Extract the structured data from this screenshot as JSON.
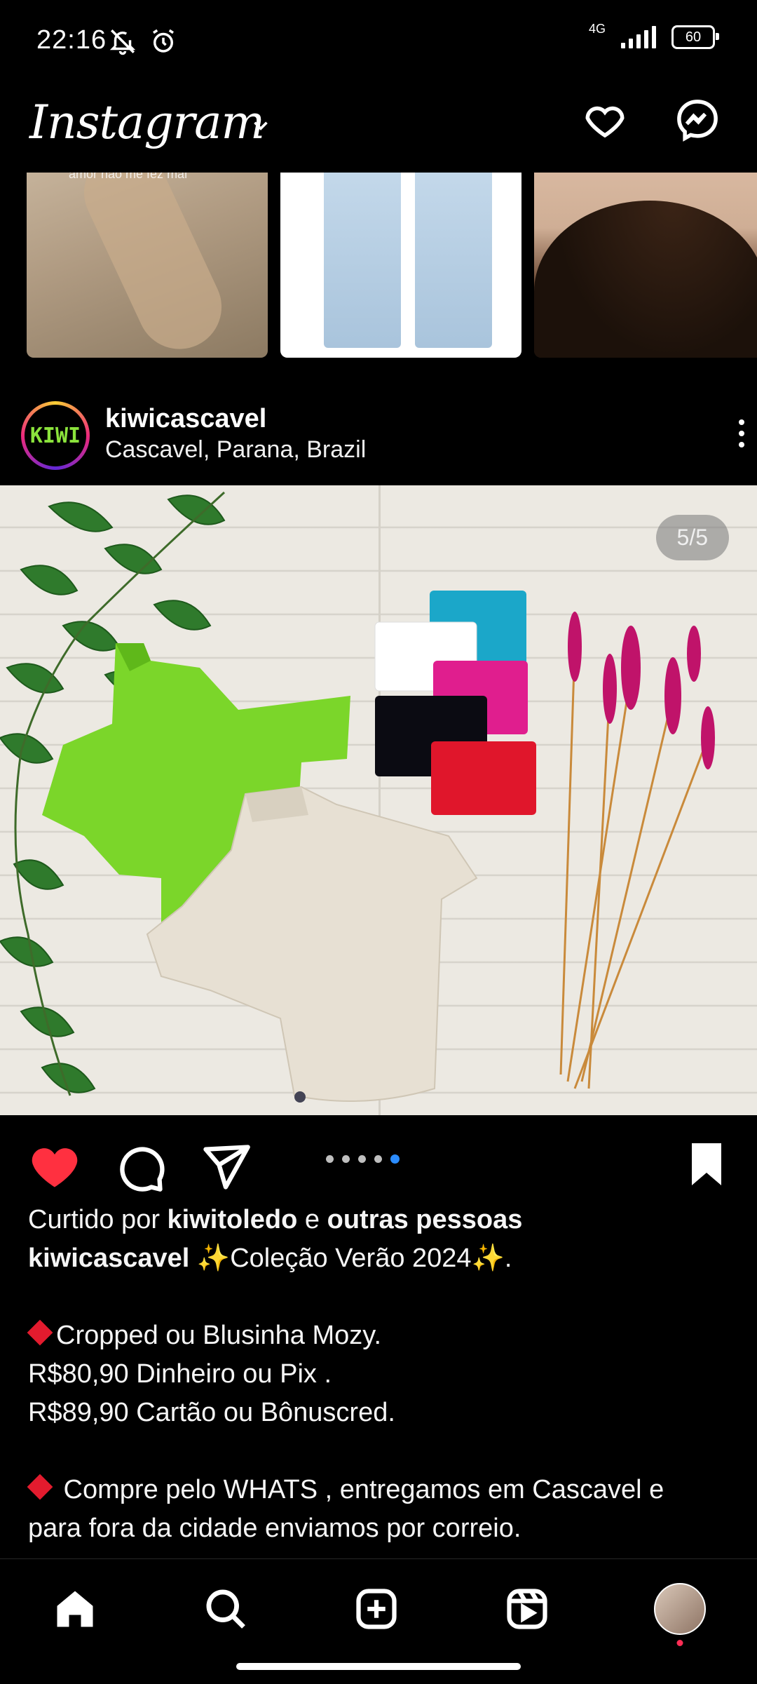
{
  "status_bar": {
    "time": "22:16",
    "network": "4G",
    "battery": "60"
  },
  "app": {
    "logo_text": "Instagram"
  },
  "stories": {
    "first_caption": "amor não me fez mal"
  },
  "post": {
    "username": "kiwicascavel",
    "location": "Cascavel, Parana, Brazil",
    "avatar_text": "KIWI",
    "image_counter": "5/5",
    "carousel": {
      "total": 5,
      "active": 5
    },
    "liked": true,
    "saved": true,
    "likes_prefix": "Curtido por",
    "likes_user": "kiwitoledo",
    "likes_mid": "e",
    "likes_suffix": "outras pessoas",
    "caption_user": "kiwicascavel",
    "caption_line1": "✨Coleção Verão 2024✨.",
    "caption_line2": "Cropped ou Blusinha Mozy.",
    "caption_line3": "R$80,90 Dinheiro ou Pix .",
    "caption_line4": "R$89,90 Cartão ou Bônuscred.",
    "caption_line5": " Compre pelo WHATS , entregamos em Cascavel e",
    "caption_line6": "para fora da cidade enviamos por correio."
  },
  "colors": {
    "like_red": "#ff3040",
    "dot_active": "#2b8cff",
    "avatar_green": "#8be33c"
  },
  "nav": [
    "home-icon",
    "search-icon",
    "create-icon",
    "reels-icon",
    "profile-avatar"
  ]
}
